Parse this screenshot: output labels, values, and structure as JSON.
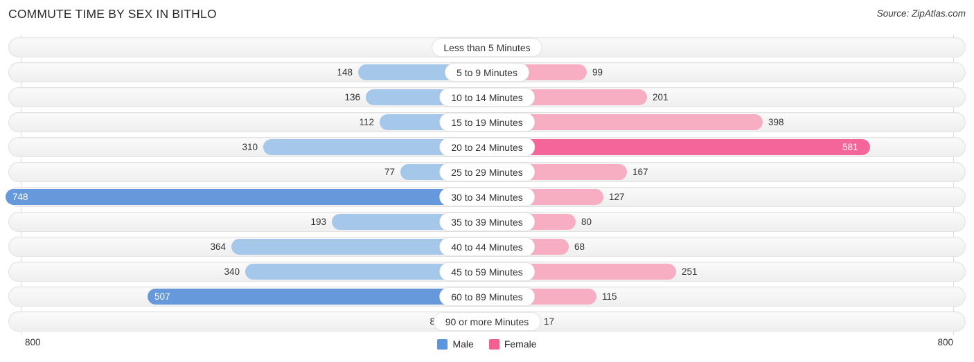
{
  "header": {
    "title": "COMMUTE TIME BY SEX IN BITHLO",
    "source": "Source: ZipAtlas.com"
  },
  "axis": {
    "left_label": "800",
    "right_label": "800",
    "max": 800
  },
  "legend": {
    "male_label": "Male",
    "female_label": "Female",
    "male_color": "#5b96dc",
    "female_color": "#f2608f"
  },
  "colors": {
    "male_light": "#a5c7ea",
    "male_strong": "#6699dc",
    "female_light": "#f7adc2",
    "female_strong": "#f4669a"
  },
  "chart_data": {
    "type": "bar",
    "title": "COMMUTE TIME BY SEX IN BITHLO",
    "subtitle": "Source: ZipAtlas.com",
    "orientation": "horizontal-diverging",
    "xlabel": "",
    "ylabel": "",
    "xlim": [
      0,
      800
    ],
    "grid": true,
    "legend_position": "bottom-center",
    "categories": [
      "Less than 5 Minutes",
      "5 to 9 Minutes",
      "10 to 14 Minutes",
      "15 to 19 Minutes",
      "20 to 24 Minutes",
      "25 to 29 Minutes",
      "30 to 34 Minutes",
      "35 to 39 Minutes",
      "40 to 44 Minutes",
      "45 to 59 Minutes",
      "60 to 89 Minutes",
      "90 or more Minutes"
    ],
    "series": [
      {
        "name": "Male",
        "values": [
          0,
          148,
          136,
          112,
          310,
          77,
          748,
          193,
          364,
          340,
          507,
          8
        ]
      },
      {
        "name": "Female",
        "values": [
          0,
          99,
          201,
          398,
          581,
          167,
          127,
          80,
          68,
          251,
          115,
          17
        ]
      }
    ]
  },
  "rows": [
    {
      "category": "Less than 5 Minutes",
      "male": 0,
      "female": 0,
      "male_text": "0",
      "female_text": "0",
      "male_inside": false,
      "female_inside": false
    },
    {
      "category": "5 to 9 Minutes",
      "male": 148,
      "female": 99,
      "male_text": "148",
      "female_text": "99",
      "male_inside": false,
      "female_inside": false
    },
    {
      "category": "10 to 14 Minutes",
      "male": 136,
      "female": 201,
      "male_text": "136",
      "female_text": "201",
      "male_inside": false,
      "female_inside": false
    },
    {
      "category": "15 to 19 Minutes",
      "male": 112,
      "female": 398,
      "male_text": "112",
      "female_text": "398",
      "male_inside": false,
      "female_inside": false
    },
    {
      "category": "20 to 24 Minutes",
      "male": 310,
      "female": 581,
      "male_text": "310",
      "female_text": "581",
      "male_inside": false,
      "female_inside": true
    },
    {
      "category": "25 to 29 Minutes",
      "male": 77,
      "female": 167,
      "male_text": "77",
      "female_text": "167",
      "male_inside": false,
      "female_inside": false
    },
    {
      "category": "30 to 34 Minutes",
      "male": 748,
      "female": 127,
      "male_text": "748",
      "female_text": "127",
      "male_inside": true,
      "female_inside": false
    },
    {
      "category": "35 to 39 Minutes",
      "male": 193,
      "female": 80,
      "male_text": "193",
      "female_text": "80",
      "male_inside": false,
      "female_inside": false
    },
    {
      "category": "40 to 44 Minutes",
      "male": 364,
      "female": 68,
      "male_text": "364",
      "female_text": "68",
      "male_inside": false,
      "female_inside": false
    },
    {
      "category": "45 to 59 Minutes",
      "male": 340,
      "female": 251,
      "male_text": "340",
      "female_text": "251",
      "male_inside": false,
      "female_inside": false
    },
    {
      "category": "60 to 89 Minutes",
      "male": 507,
      "female": 115,
      "male_text": "507",
      "female_text": "115",
      "male_inside": true,
      "female_inside": false
    },
    {
      "category": "90 or more Minutes",
      "male": 8,
      "female": 17,
      "male_text": "8",
      "female_text": "17",
      "male_inside": false,
      "female_inside": false
    }
  ]
}
